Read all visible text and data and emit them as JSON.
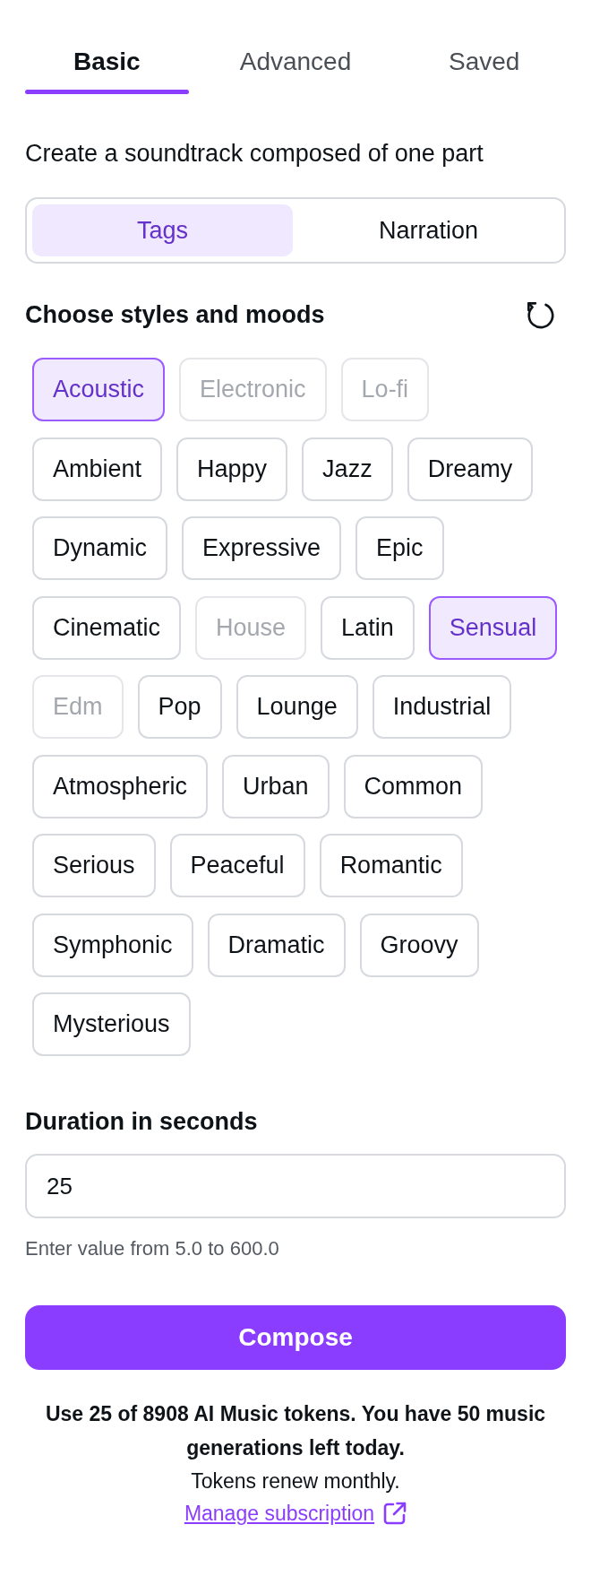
{
  "tabs": [
    {
      "label": "Basic",
      "selected": true
    },
    {
      "label": "Advanced",
      "selected": false
    },
    {
      "label": "Saved",
      "selected": false
    }
  ],
  "description": "Create a soundtrack composed of one part",
  "mode_switch": [
    {
      "label": "Tags",
      "selected": true
    },
    {
      "label": "Narration",
      "selected": false
    }
  ],
  "styles": {
    "heading": "Choose styles and moods",
    "tags": [
      {
        "label": "Acoustic",
        "selected": true,
        "disabled": false
      },
      {
        "label": "Electronic",
        "selected": false,
        "disabled": true
      },
      {
        "label": "Lo-fi",
        "selected": false,
        "disabled": true
      },
      {
        "label": "Ambient",
        "selected": false,
        "disabled": false
      },
      {
        "label": "Happy",
        "selected": false,
        "disabled": false
      },
      {
        "label": "Jazz",
        "selected": false,
        "disabled": false
      },
      {
        "label": "Dreamy",
        "selected": false,
        "disabled": false
      },
      {
        "label": "Dynamic",
        "selected": false,
        "disabled": false
      },
      {
        "label": "Expressive",
        "selected": false,
        "disabled": false
      },
      {
        "label": "Epic",
        "selected": false,
        "disabled": false
      },
      {
        "label": "Cinematic",
        "selected": false,
        "disabled": false
      },
      {
        "label": "House",
        "selected": false,
        "disabled": true
      },
      {
        "label": "Latin",
        "selected": false,
        "disabled": false
      },
      {
        "label": "Sensual",
        "selected": true,
        "disabled": false
      },
      {
        "label": "Edm",
        "selected": false,
        "disabled": true
      },
      {
        "label": "Pop",
        "selected": false,
        "disabled": false
      },
      {
        "label": "Lounge",
        "selected": false,
        "disabled": false
      },
      {
        "label": "Industrial",
        "selected": false,
        "disabled": false
      },
      {
        "label": "Atmospheric",
        "selected": false,
        "disabled": false
      },
      {
        "label": "Urban",
        "selected": false,
        "disabled": false
      },
      {
        "label": "Common",
        "selected": false,
        "disabled": false
      },
      {
        "label": "Serious",
        "selected": false,
        "disabled": false
      },
      {
        "label": "Peaceful",
        "selected": false,
        "disabled": false
      },
      {
        "label": "Romantic",
        "selected": false,
        "disabled": false
      },
      {
        "label": "Symphonic",
        "selected": false,
        "disabled": false
      },
      {
        "label": "Dramatic",
        "selected": false,
        "disabled": false
      },
      {
        "label": "Groovy",
        "selected": false,
        "disabled": false
      },
      {
        "label": "Mysterious",
        "selected": false,
        "disabled": false
      }
    ]
  },
  "duration": {
    "label": "Duration in seconds",
    "value": "25",
    "hint": "Enter value from 5.0 to 600.0"
  },
  "compose_button": "Compose",
  "usage": {
    "note": "Use 25 of 8908 AI Music tokens. You have 50 music generations left today.",
    "renewal": "Tokens renew monthly.",
    "link": "Manage subscription"
  }
}
